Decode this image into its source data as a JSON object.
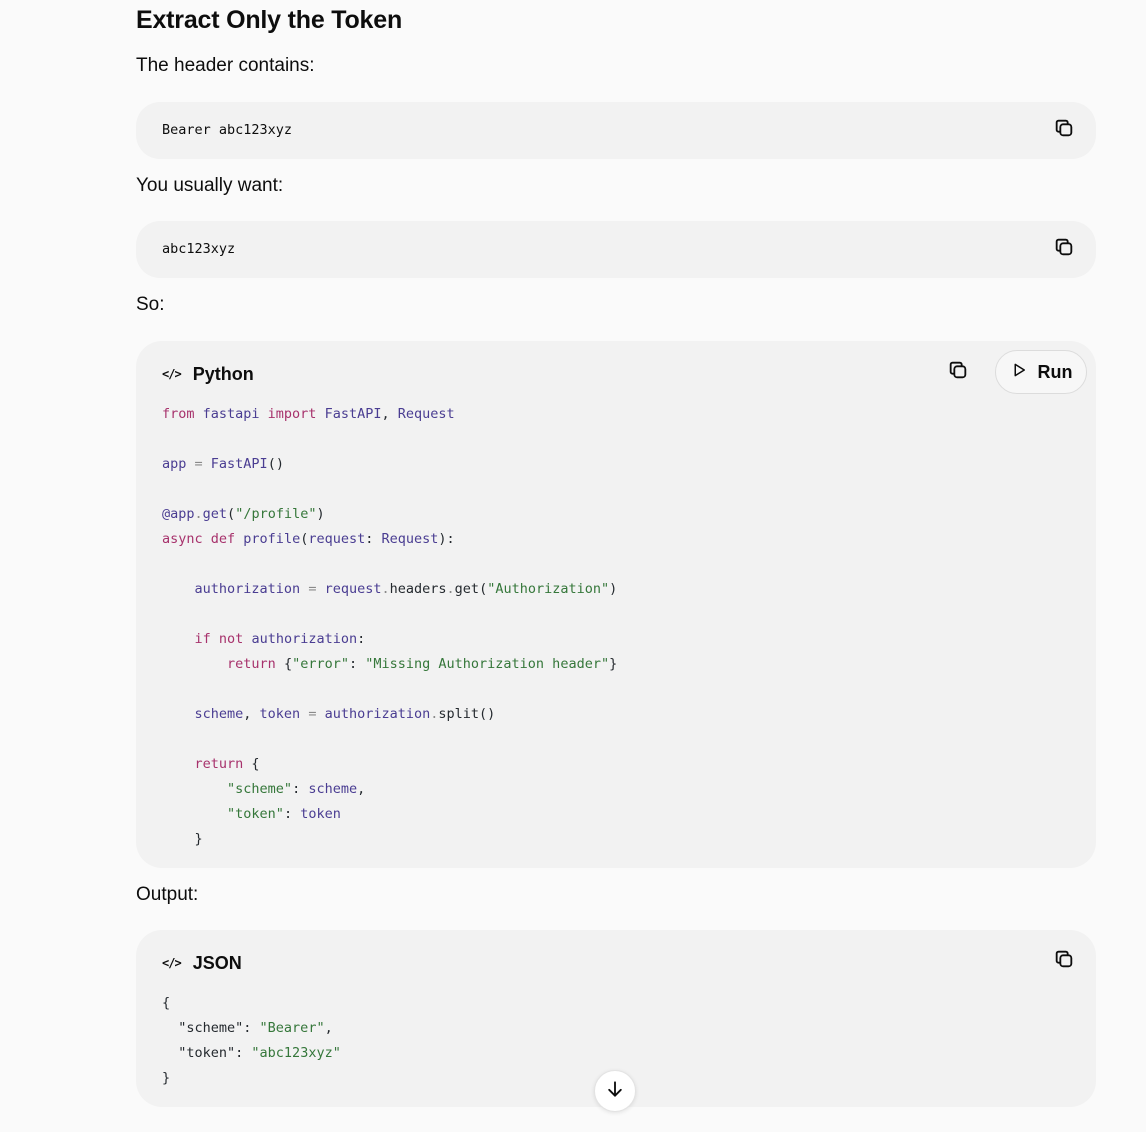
{
  "heading": "Extract Only the Token",
  "paragraphs": {
    "header_contains": "The header contains:",
    "usually_want": "You usually want:",
    "so": "So:",
    "output": "Output:"
  },
  "inline_blocks": [
    {
      "code": "Bearer abc123xyz",
      "copy_icon": "copy-icon"
    },
    {
      "code": "abc123xyz",
      "copy_icon": "copy-icon"
    }
  ],
  "python_block": {
    "language": "Python",
    "lang_icon_glyph": "</>",
    "run_label": "Run",
    "lines": [
      [
        {
          "t": "from",
          "c": "kw"
        },
        {
          "t": " fastapi ",
          "c": "fn"
        },
        {
          "t": "import",
          "c": "kw"
        },
        {
          "t": " FastAPI",
          "c": "fn"
        },
        {
          "t": ", ",
          "c": "pl"
        },
        {
          "t": "Request",
          "c": "fn"
        }
      ],
      [],
      [
        {
          "t": "app ",
          "c": "fn"
        },
        {
          "t": "=",
          "c": "op"
        },
        {
          "t": " FastAPI",
          "c": "fn"
        },
        {
          "t": "()",
          "c": "pl"
        }
      ],
      [],
      [
        {
          "t": "@app",
          "c": "fn"
        },
        {
          "t": ".",
          "c": "op"
        },
        {
          "t": "get",
          "c": "fn"
        },
        {
          "t": "(",
          "c": "pl"
        },
        {
          "t": "\"/profile\"",
          "c": "str"
        },
        {
          "t": ")",
          "c": "pl"
        }
      ],
      [
        {
          "t": "async",
          "c": "kw"
        },
        {
          "t": " ",
          "c": "pl"
        },
        {
          "t": "def",
          "c": "kw"
        },
        {
          "t": " profile",
          "c": "fn"
        },
        {
          "t": "(",
          "c": "pl"
        },
        {
          "t": "request",
          "c": "fn"
        },
        {
          "t": ": ",
          "c": "pl"
        },
        {
          "t": "Request",
          "c": "fn"
        },
        {
          "t": "):",
          "c": "pl"
        }
      ],
      [],
      [
        {
          "t": "    authorization ",
          "c": "fn"
        },
        {
          "t": "=",
          "c": "op"
        },
        {
          "t": " request",
          "c": "fn"
        },
        {
          "t": ".",
          "c": "op"
        },
        {
          "t": "headers",
          "c": "pl"
        },
        {
          "t": ".",
          "c": "op"
        },
        {
          "t": "get",
          "c": "pl"
        },
        {
          "t": "(",
          "c": "pl"
        },
        {
          "t": "\"Authorization\"",
          "c": "str"
        },
        {
          "t": ")",
          "c": "pl"
        }
      ],
      [],
      [
        {
          "t": "    ",
          "c": "pl"
        },
        {
          "t": "if",
          "c": "kw"
        },
        {
          "t": " ",
          "c": "pl"
        },
        {
          "t": "not",
          "c": "kw"
        },
        {
          "t": " authorization",
          "c": "fn"
        },
        {
          "t": ":",
          "c": "pl"
        }
      ],
      [
        {
          "t": "        ",
          "c": "pl"
        },
        {
          "t": "return",
          "c": "kw"
        },
        {
          "t": " {",
          "c": "pl"
        },
        {
          "t": "\"error\"",
          "c": "str"
        },
        {
          "t": ": ",
          "c": "pl"
        },
        {
          "t": "\"Missing Authorization header\"",
          "c": "str"
        },
        {
          "t": "}",
          "c": "pl"
        }
      ],
      [],
      [
        {
          "t": "    scheme",
          "c": "fn"
        },
        {
          "t": ", ",
          "c": "pl"
        },
        {
          "t": "token ",
          "c": "fn"
        },
        {
          "t": "=",
          "c": "op"
        },
        {
          "t": " authorization",
          "c": "fn"
        },
        {
          "t": ".",
          "c": "op"
        },
        {
          "t": "split",
          "c": "pl"
        },
        {
          "t": "()",
          "c": "pl"
        }
      ],
      [],
      [
        {
          "t": "    ",
          "c": "pl"
        },
        {
          "t": "return",
          "c": "kw"
        },
        {
          "t": " {",
          "c": "pl"
        }
      ],
      [
        {
          "t": "        ",
          "c": "pl"
        },
        {
          "t": "\"scheme\"",
          "c": "str"
        },
        {
          "t": ": ",
          "c": "pl"
        },
        {
          "t": "scheme",
          "c": "fn"
        },
        {
          "t": ",",
          "c": "pl"
        }
      ],
      [
        {
          "t": "        ",
          "c": "pl"
        },
        {
          "t": "\"token\"",
          "c": "str"
        },
        {
          "t": ": ",
          "c": "pl"
        },
        {
          "t": "token",
          "c": "fn"
        }
      ],
      [
        {
          "t": "    }",
          "c": "pl"
        }
      ]
    ]
  },
  "json_block": {
    "language": "JSON",
    "lang_icon_glyph": "</>",
    "lines": [
      [
        {
          "t": "{",
          "c": "pl"
        }
      ],
      [
        {
          "t": "  \"scheme\"",
          "c": "pl"
        },
        {
          "t": ": ",
          "c": "pl"
        },
        {
          "t": "\"Bearer\"",
          "c": "str"
        },
        {
          "t": ",",
          "c": "pl"
        }
      ],
      [
        {
          "t": "  \"token\"",
          "c": "pl"
        },
        {
          "t": ": ",
          "c": "pl"
        },
        {
          "t": "\"abc123xyz\"",
          "c": "str"
        }
      ],
      [
        {
          "t": "}",
          "c": "pl"
        }
      ]
    ]
  },
  "icons": {
    "copy": "copy-icon",
    "code": "code-icon",
    "play": "play-icon",
    "scroll_down": "arrow-down-icon"
  },
  "colors": {
    "keyword": "#a7326c",
    "identifier": "#4a3d92",
    "string": "#35773a",
    "block_bg": "#f2f2f2",
    "page_bg": "#fafafa"
  }
}
